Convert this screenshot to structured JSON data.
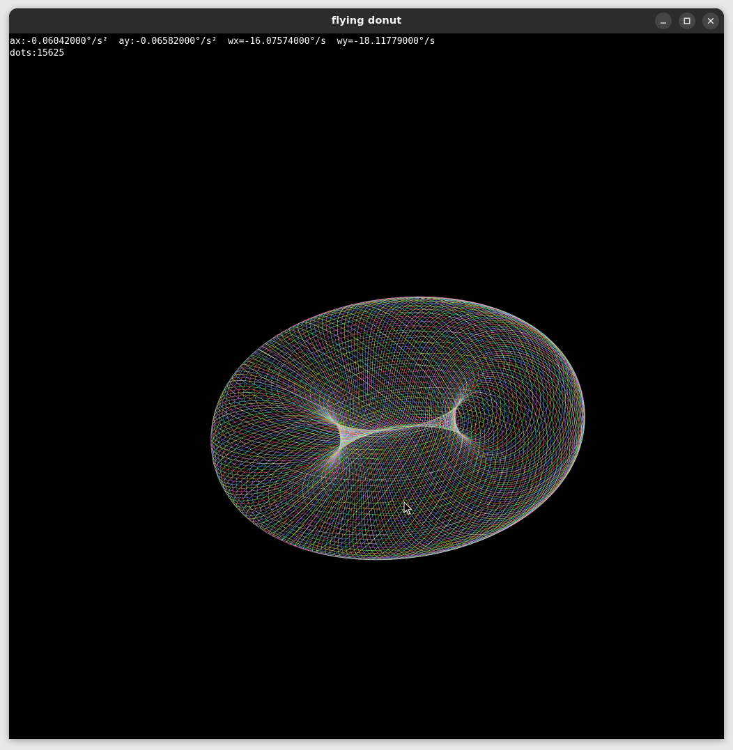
{
  "window": {
    "title": "flying donut"
  },
  "hud": {
    "line1": "ax:-0.06042000°/s²  ay:-0.06582000°/s²  wx=-16.07574000°/s  wy=-18.11779000°/s",
    "line2": "dots:15625"
  },
  "controls": {
    "minimize": "minimize-icon",
    "maximize": "maximize-icon",
    "close": "close-icon"
  },
  "colors": {
    "titlebar": "#2c2c2c",
    "background": "#000000",
    "text": "#ffffff"
  }
}
